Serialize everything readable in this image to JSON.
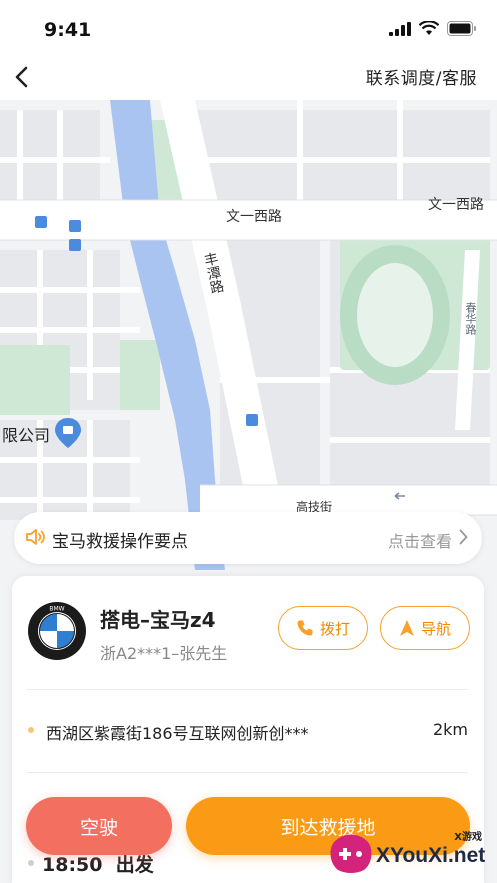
{
  "status_bar": {
    "time": "9:41"
  },
  "nav": {
    "action": "联系调度/客服"
  },
  "map": {
    "roads": {
      "wenyi_west_1": "文一西路",
      "wenyi_west_2": "文一西路",
      "fengtan": "丰潭路",
      "chunhua": "春华路",
      "gaoji": "高技街"
    },
    "poi": "限公司"
  },
  "tips": {
    "title": "宝马救援操作要点",
    "action": "点击查看"
  },
  "order": {
    "brand": "BMW",
    "title": "搭电–宝马z4",
    "plate": "浙A2***1–张先生",
    "call_label": "拨打",
    "navigate_label": "导航",
    "address": "西湖区紫霞街186号互联网创新创***",
    "distance": "2km",
    "depart_time": "18:50",
    "depart_label": "出发"
  },
  "actions": {
    "empty_label": "空驶",
    "arrive_label": "到达救援地"
  },
  "watermark": {
    "small": "X游戏",
    "text": "XYouXi.net"
  },
  "colors": {
    "accent_orange": "#fb9a14",
    "accent_red": "#f36f5f",
    "river": "#a9c4f0",
    "park": "#cfe8d6"
  }
}
